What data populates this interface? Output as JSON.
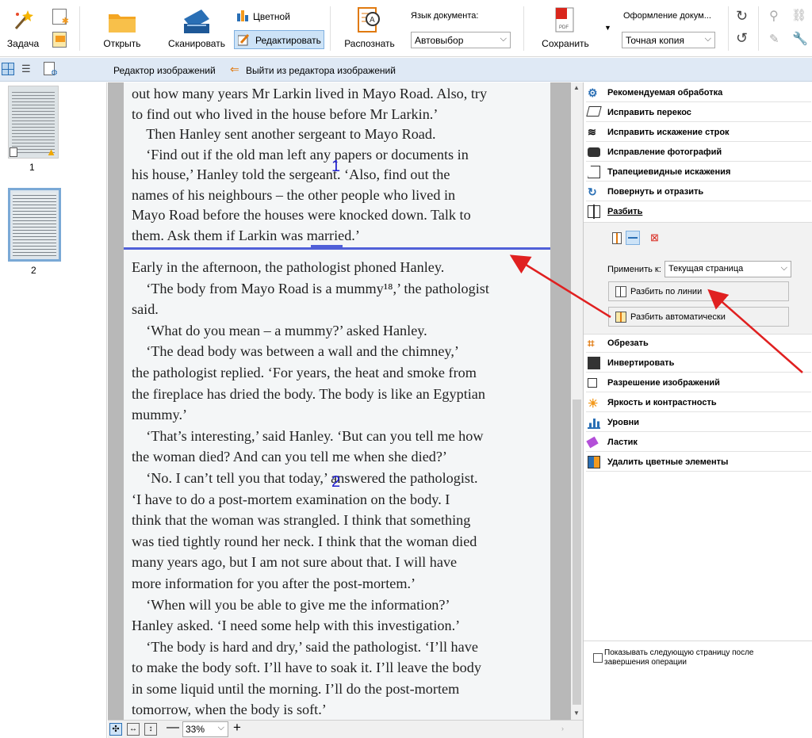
{
  "toolbar": {
    "task_label": "Задача",
    "open_label": "Открыть",
    "scan_label": "Сканировать",
    "color_label": "Цветной",
    "edit_label": "Редактировать",
    "recognize_label": "Распознать",
    "doc_lang_label": "Язык документа:",
    "doc_lang_value": "Автовыбор",
    "save_label": "Сохранить",
    "doc_format_label": "Оформление докум...",
    "doc_format_value": "Точная копия"
  },
  "subbar": {
    "image_editor_label": "Редактор изображений",
    "exit_editor_label": "Выйти из редактора изображений"
  },
  "thumbnails": [
    {
      "page_number": "1",
      "warning": true
    },
    {
      "page_number": "2",
      "selected": true
    }
  ],
  "document": {
    "area1_label": "1",
    "area2_label": "2",
    "lines_top": [
      "out how many years Mr Larkin lived in Mayo Road. Also, try",
      "to find out who lived in the house before Mr Larkin.’",
      "    Then Hanley sent another sergeant to Mayo Road.",
      "    ‘Find out if the old man left any papers or documents in",
      "his house,’ Hanley told the sergeant. ‘Also, find out the",
      "names of his neighbours – the other people who lived in",
      "Mayo Road before the houses were knocked down. Talk to",
      "them. Ask them if Larkin was married.’"
    ],
    "lines_bottom": [
      "Early in the afternoon, the pathologist phoned Hanley.",
      "    ‘The body from Mayo Road is a mummy¹⁸,’ the pathologist",
      "said.",
      "    ‘What do you mean – a mummy?’ asked Hanley.",
      "    ‘The dead body was between a wall and the chimney,’",
      "the pathologist replied. ‘For years, the heat and smoke from",
      "the fireplace has dried the body. The body is like an Egyptian",
      "mummy.’",
      "    ‘That’s interesting,’ said Hanley. ‘But can you tell me how",
      "the woman died? And can you tell me when she died?’",
      "    ‘No. I can’t tell you that today,’ answered the pathologist.",
      "‘I have to do a post-mortem examination on the body. I",
      "think that the woman was strangled. I think that something",
      "was tied tightly round her neck. I think that the woman died",
      "many years ago, but I am not sure about that. I will have",
      "more information for you after the post-mortem.’",
      "    ‘When will you be able to give me the information?’",
      "Hanley asked. ‘I need some help with this investigation.’",
      "    ‘The body is hard and dry,’ said the pathologist. ‘I’ll have",
      "to make the body soft. I’ll have to soak it. I’ll leave the body",
      "in some liquid until the morning. I’ll do the post-mortem",
      "tomorrow, when the body is soft.’"
    ]
  },
  "zoom": {
    "value": "33%"
  },
  "panel": {
    "items": [
      "Рекомендуемая обработка",
      "Исправить перекос",
      "Исправить искажение строк",
      "Исправление фотографий",
      "Трапециевидные искажения",
      "Повернуть и отразить",
      "Разбить"
    ],
    "apply_to_label": "Применить к:",
    "apply_to_value": "Текущая страница",
    "split_by_line_label": "Разбить по линии",
    "split_auto_label": "Разбить автоматически",
    "items2": [
      "Обрезать",
      "Инвертировать",
      "Разрешение изображений",
      "Яркость и контрастность",
      "Уровни",
      "Ластик",
      "Удалить цветные элементы"
    ],
    "show_next_label": "Показывать следующую страницу после завершения операции"
  },
  "colors": {
    "split_line": "#5060d8",
    "annotation_arrow": "#e02020",
    "accent_orange": "#f39a1e",
    "accent_blue": "#2a6fb5"
  }
}
